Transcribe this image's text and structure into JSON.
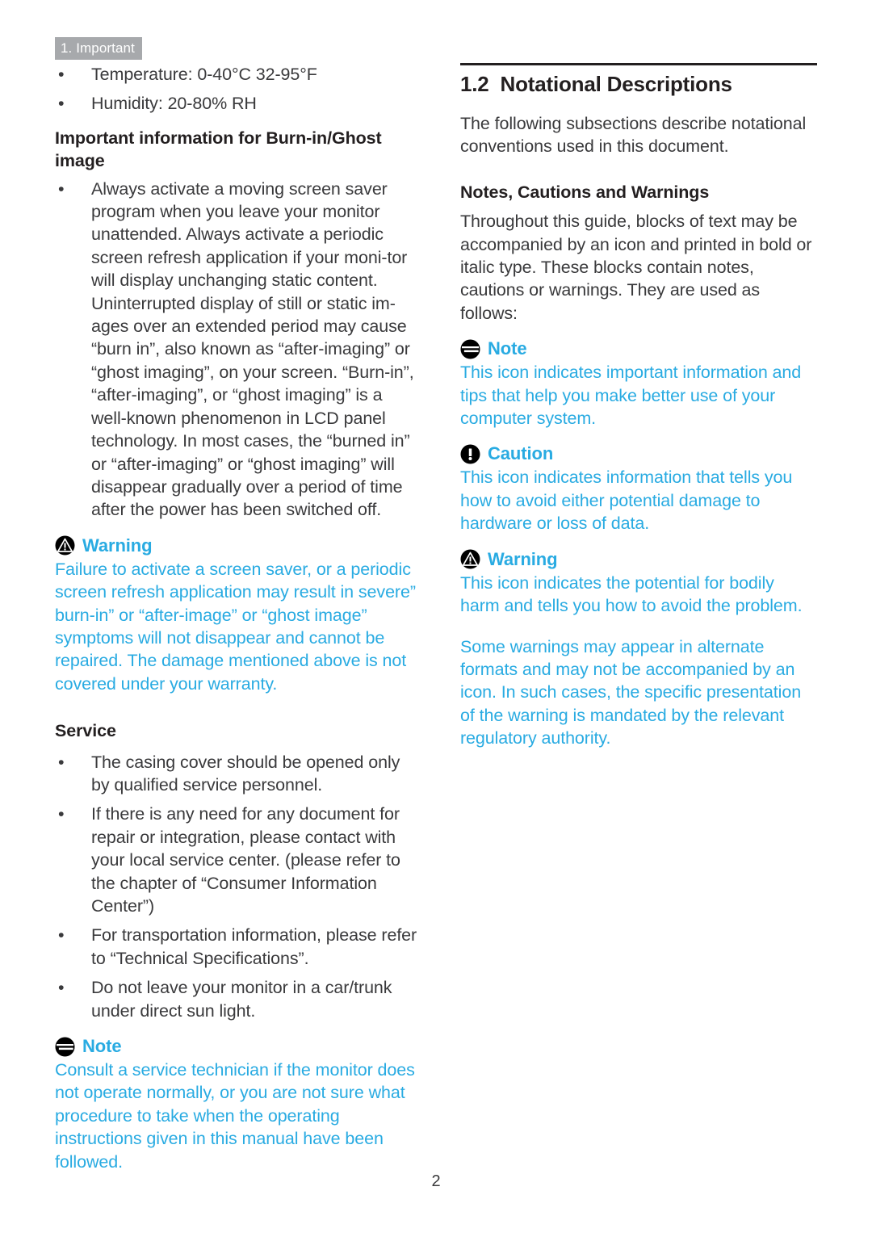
{
  "page": {
    "chapter_tab": "1. Important",
    "page_number": "2",
    "accent_color": "#29abe2",
    "tab_background": "#a7a9ac",
    "body_color": "#3a3a3c"
  },
  "left_column": {
    "spec_bullets": [
      "Temperature: 0-40°C 32-95°F",
      "Humidity: 20-80% RH"
    ],
    "burnin_heading": "Important information for Burn-in/Ghost image",
    "burnin_bullets": [
      "Always activate a moving screen saver program when you leave your monitor unattended. Always activate a periodic screen refresh application if your moni-tor will display unchanging static content. Uninterrupted display of still or static im-ages over an extended period may cause “burn in”, also known as “after-imaging” or “ghost imaging”, on your screen. “Burn-in”, “after-imaging”, or “ghost imaging” is a well-known phenomenon in LCD panel technology. In most cases, the “burned in” or “after-imaging” or “ghost imaging” will disappear gradually over a period of time after the power has been switched off."
    ],
    "warning_callout": {
      "icon": "warning-icon",
      "label": "Warning",
      "body": "Failure to activate a screen saver, or a periodic screen refresh application may result in severe” burn-in” or “after-image” or “ghost image” symptoms will not disappear and cannot be repaired. The damage mentioned above is not covered under your warranty."
    },
    "service_heading": "Service",
    "service_bullets": [
      "The casing cover should be opened only by qualified service personnel.",
      "If there is any need for any document for repair or integration, please contact with your local service center. (please refer to the chapter of “Consumer Information Center”)",
      "For transportation information, please refer to “Technical Specifications”.",
      "Do not leave your monitor in a car/trunk under direct sun light."
    ],
    "note_callout": {
      "icon": "note-icon",
      "label": "Note",
      "body": "Consult a service technician if the monitor does not operate normally, or you are not sure what procedure to take when the operating instructions given in this manual have been followed."
    }
  },
  "right_column": {
    "section_number": "1.2",
    "section_title": "Notational Descriptions",
    "intro": "The following subsections describe notational conventions used in this document.",
    "subheading": "Notes, Cautions and Warnings",
    "subintro": "Throughout this guide, blocks of text may be accompanied by an icon and printed in bold or italic type. These blocks contain notes, cautions or warnings. They are used as follows:",
    "note_callout": {
      "icon": "note-icon",
      "label": "Note",
      "body": "This icon indicates important information and tips that help you make better use of your computer system."
    },
    "caution_callout": {
      "icon": "caution-icon",
      "label": "Caution",
      "body": "This icon indicates information that tells you how to avoid either potential damage to hardware or loss of data."
    },
    "warning_callout": {
      "icon": "warning-icon",
      "label": "Warning",
      "body": "This icon indicates the potential for bodily harm and tells you how to avoid the problem.",
      "body2": "Some warnings may appear in alternate formats and may not be accompanied by an icon. In such cases, the specific presentation of the warning is mandated by the relevant regulatory authority."
    }
  }
}
